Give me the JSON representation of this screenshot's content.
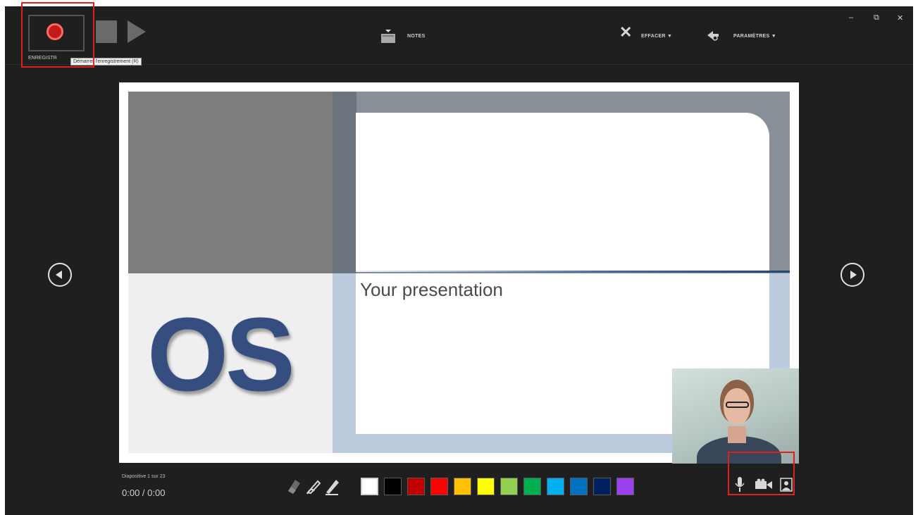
{
  "toolbar": {
    "record_label": "ENREGISTR",
    "record_tooltip": "Démarrer l'enregistrement (R)",
    "notes_label": "NOTES",
    "clear_label": "EFFACER ▼",
    "settings_label": "PARAMÈTRES ▼"
  },
  "window_controls": {
    "minimize": "–",
    "restore": "⧉",
    "close": "✕"
  },
  "slide": {
    "title": "Your presentation",
    "logo_text": "OS"
  },
  "footer": {
    "slide_info": "Diapositive 1 sur 23",
    "timer": "0:00 / 0:00"
  },
  "pen_colors": [
    "#ffffff",
    "#000000",
    "#c00000",
    "#ff0000",
    "#ffc000",
    "#ffff00",
    "#92d050",
    "#00b050",
    "#00b0f0",
    "#0070c0",
    "#002060",
    "#9b3ff0"
  ],
  "selected_color_index": 0,
  "icons": {
    "record": "record-icon",
    "stop": "stop-icon",
    "play": "play-icon",
    "notes": "notes-icon",
    "clear": "clear-x-icon",
    "settings": "settings-icon",
    "eraser": "eraser-icon",
    "pen": "pen-icon",
    "highlighter": "highlighter-icon",
    "microphone": "microphone-icon",
    "camera": "camera-icon",
    "camera_preview": "camera-preview-icon",
    "prev": "previous-slide-icon",
    "next": "next-slide-icon"
  },
  "colors": {
    "background": "#1f1f1f",
    "highlight": "#e0201c",
    "record": "#c11b17"
  }
}
